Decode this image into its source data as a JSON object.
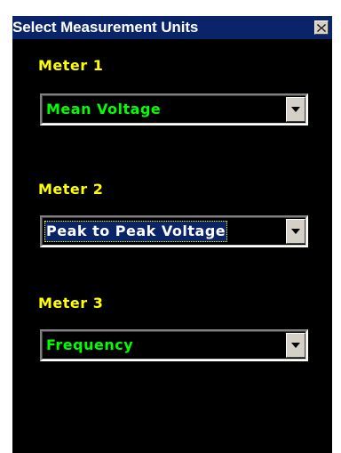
{
  "window": {
    "title": "Select Measurement Units"
  },
  "meters": [
    {
      "label": "Meter 1",
      "value": "Mean Voltage",
      "focused": false
    },
    {
      "label": "Meter 2",
      "value": "Peak to Peak Voltage",
      "focused": true
    },
    {
      "label": "Meter 3",
      "value": "Frequency",
      "focused": false
    }
  ],
  "colors": {
    "title_bar": "#0a246a",
    "panel_background": "#000000",
    "label_text": "#ffff00",
    "value_text": "#00ff00",
    "selected_background": "#0a246a",
    "selected_text": "#ffffff",
    "button_face": "#d4d0c8"
  },
  "icons": {
    "close": "close-icon",
    "dropdown": "chevron-down-icon"
  }
}
